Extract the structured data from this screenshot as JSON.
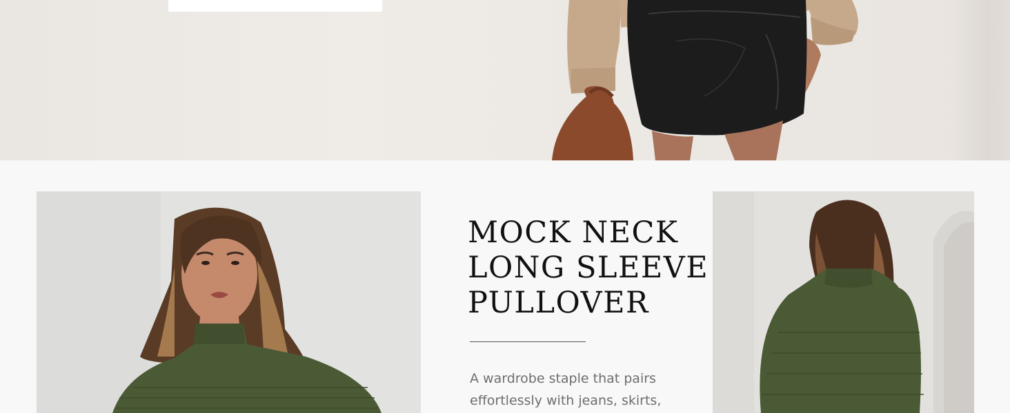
{
  "product": {
    "title_lines": [
      "MOCK NECK",
      "LONG SLEEVE",
      "PULLOVER"
    ],
    "description": "A wardrobe staple that pairs effortlessly with jeans, skirts,"
  },
  "images": {
    "hero": "model-in-beige-sweater-and-black-leather-skirt",
    "front": "model-in-green-mock-neck-sweater-front",
    "back": "model-in-green-mock-neck-sweater-back"
  },
  "colors": {
    "sweater_green": "#4a5a35",
    "sweater_beige": "#c6a98a",
    "skirt_black": "#1c1c1c",
    "bag_brown": "#8b4a2b",
    "title_text": "#111111",
    "body_text": "#6d6d6d"
  }
}
